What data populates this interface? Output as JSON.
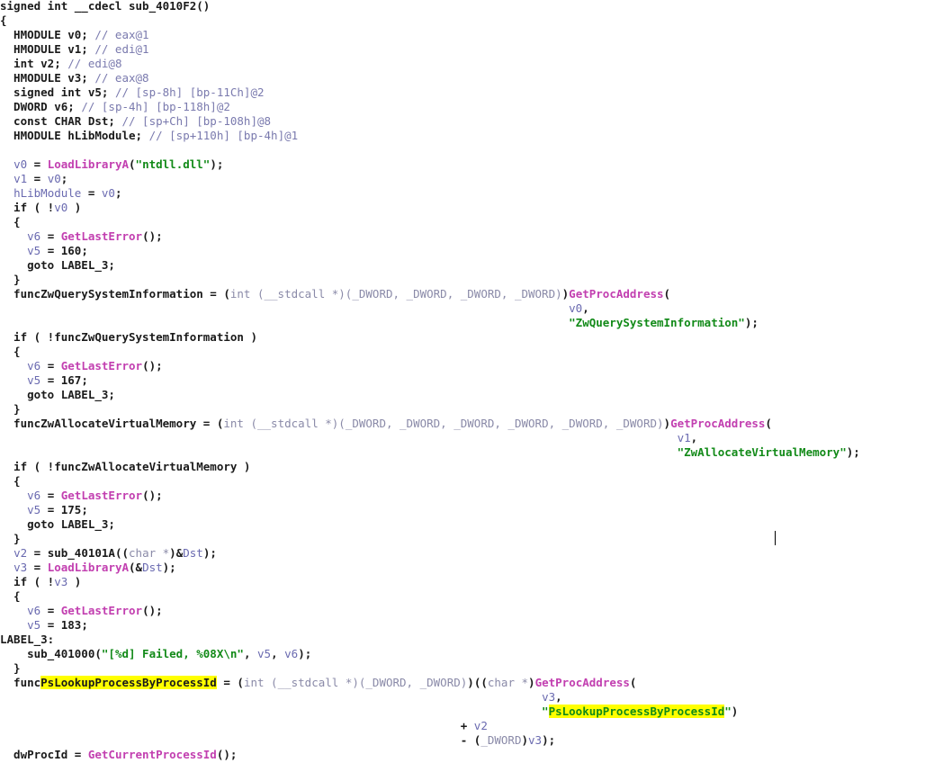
{
  "editor": {
    "kind": "decompiler-pseudocode",
    "colors": {
      "default": "#1a1a1a",
      "comment": "#7a7aae",
      "variable": "#6a6ab0",
      "function": "#c23fb0",
      "string": "#128a18",
      "highlight": "#ffff00",
      "background": "#ffffff"
    },
    "lines": [
      [
        {
          "t": "signed int __cdecl sub_4010F2()",
          "c": "default"
        }
      ],
      [
        {
          "t": "{",
          "c": "default"
        }
      ],
      [
        {
          "t": "  HMODULE v0; ",
          "c": "default"
        },
        {
          "t": "// eax@1",
          "c": "comment"
        }
      ],
      [
        {
          "t": "  HMODULE v1; ",
          "c": "default"
        },
        {
          "t": "// edi@1",
          "c": "comment"
        }
      ],
      [
        {
          "t": "  int v2; ",
          "c": "default"
        },
        {
          "t": "// edi@8",
          "c": "comment"
        }
      ],
      [
        {
          "t": "  HMODULE v3; ",
          "c": "default"
        },
        {
          "t": "// eax@8",
          "c": "comment"
        }
      ],
      [
        {
          "t": "  signed int v5; ",
          "c": "default"
        },
        {
          "t": "// [sp-8h] [bp-11Ch]@2",
          "c": "comment"
        }
      ],
      [
        {
          "t": "  DWORD v6; ",
          "c": "default"
        },
        {
          "t": "// [sp-4h] [bp-118h]@2",
          "c": "comment"
        }
      ],
      [
        {
          "t": "  const CHAR Dst; ",
          "c": "default"
        },
        {
          "t": "// [sp+Ch] [bp-108h]@8",
          "c": "comment"
        }
      ],
      [
        {
          "t": "  HMODULE hLibModule; ",
          "c": "default"
        },
        {
          "t": "// [sp+110h] [bp-4h]@1",
          "c": "comment"
        }
      ],
      [
        {
          "t": "",
          "c": "default"
        }
      ],
      [
        {
          "t": "  ",
          "c": "default"
        },
        {
          "t": "v0",
          "c": "var"
        },
        {
          "t": " = ",
          "c": "default"
        },
        {
          "t": "LoadLibraryA",
          "c": "func"
        },
        {
          "t": "(",
          "c": "default"
        },
        {
          "t": "\"ntdll.dll\"",
          "c": "string"
        },
        {
          "t": ");",
          "c": "default"
        }
      ],
      [
        {
          "t": "  ",
          "c": "default"
        },
        {
          "t": "v1",
          "c": "var"
        },
        {
          "t": " = ",
          "c": "default"
        },
        {
          "t": "v0",
          "c": "var"
        },
        {
          "t": ";",
          "c": "default"
        }
      ],
      [
        {
          "t": "  ",
          "c": "default"
        },
        {
          "t": "hLibModule",
          "c": "var"
        },
        {
          "t": " = ",
          "c": "default"
        },
        {
          "t": "v0",
          "c": "var"
        },
        {
          "t": ";",
          "c": "default"
        }
      ],
      [
        {
          "t": "  if ( !",
          "c": "default"
        },
        {
          "t": "v0",
          "c": "var"
        },
        {
          "t": " )",
          "c": "default"
        }
      ],
      [
        {
          "t": "  {",
          "c": "default"
        }
      ],
      [
        {
          "t": "    ",
          "c": "default"
        },
        {
          "t": "v6",
          "c": "var"
        },
        {
          "t": " = ",
          "c": "default"
        },
        {
          "t": "GetLastError",
          "c": "func"
        },
        {
          "t": "();",
          "c": "default"
        }
      ],
      [
        {
          "t": "    ",
          "c": "default"
        },
        {
          "t": "v5",
          "c": "var"
        },
        {
          "t": " = 160;",
          "c": "default"
        }
      ],
      [
        {
          "t": "    goto LABEL_3;",
          "c": "default"
        }
      ],
      [
        {
          "t": "  }",
          "c": "default"
        }
      ],
      [
        {
          "t": "  funcZwQuerySystemInformation = (",
          "c": "default"
        },
        {
          "t": "int (__stdcall *)(_DWORD, _DWORD, _DWORD, _DWORD)",
          "c": "type"
        },
        {
          "t": ")",
          "c": "default"
        },
        {
          "t": "GetProcAddress",
          "c": "func"
        },
        {
          "t": "(",
          "c": "default"
        }
      ],
      [
        {
          "t": "                                                                                    ",
          "c": "default"
        },
        {
          "t": "v0",
          "c": "var"
        },
        {
          "t": ",",
          "c": "default"
        }
      ],
      [
        {
          "t": "                                                                                    ",
          "c": "default"
        },
        {
          "t": "\"ZwQuerySystemInformation\"",
          "c": "string"
        },
        {
          "t": ");",
          "c": "default"
        }
      ],
      [
        {
          "t": "  if ( !funcZwQuerySystemInformation )",
          "c": "default"
        }
      ],
      [
        {
          "t": "  {",
          "c": "default"
        }
      ],
      [
        {
          "t": "    ",
          "c": "default"
        },
        {
          "t": "v6",
          "c": "var"
        },
        {
          "t": " = ",
          "c": "default"
        },
        {
          "t": "GetLastError",
          "c": "func"
        },
        {
          "t": "();",
          "c": "default"
        }
      ],
      [
        {
          "t": "    ",
          "c": "default"
        },
        {
          "t": "v5",
          "c": "var"
        },
        {
          "t": " = 167;",
          "c": "default"
        }
      ],
      [
        {
          "t": "    goto LABEL_3;",
          "c": "default"
        }
      ],
      [
        {
          "t": "  }",
          "c": "default"
        }
      ],
      [
        {
          "t": "  funcZwAllocateVirtualMemory = (",
          "c": "default"
        },
        {
          "t": "int (__stdcall *)(_DWORD, _DWORD, _DWORD, _DWORD, _DWORD, _DWORD)",
          "c": "type"
        },
        {
          "t": ")",
          "c": "default"
        },
        {
          "t": "GetProcAddress",
          "c": "func"
        },
        {
          "t": "(",
          "c": "default"
        }
      ],
      [
        {
          "t": "                                                                                                    ",
          "c": "default"
        },
        {
          "t": "v1",
          "c": "var"
        },
        {
          "t": ",",
          "c": "default"
        }
      ],
      [
        {
          "t": "                                                                                                    ",
          "c": "default"
        },
        {
          "t": "\"ZwAllocateVirtualMemory\"",
          "c": "string"
        },
        {
          "t": ");",
          "c": "default"
        }
      ],
      [
        {
          "t": "  if ( !funcZwAllocateVirtualMemory )",
          "c": "default"
        }
      ],
      [
        {
          "t": "  {",
          "c": "default"
        }
      ],
      [
        {
          "t": "    ",
          "c": "default"
        },
        {
          "t": "v6",
          "c": "var"
        },
        {
          "t": " = ",
          "c": "default"
        },
        {
          "t": "GetLastError",
          "c": "func"
        },
        {
          "t": "();",
          "c": "default"
        }
      ],
      [
        {
          "t": "    ",
          "c": "default"
        },
        {
          "t": "v5",
          "c": "var"
        },
        {
          "t": " = 175;",
          "c": "default"
        }
      ],
      [
        {
          "t": "    goto LABEL_3;",
          "c": "default"
        }
      ],
      [
        {
          "t": "  }",
          "c": "default"
        }
      ],
      [
        {
          "t": "  ",
          "c": "default"
        },
        {
          "t": "v2",
          "c": "var"
        },
        {
          "t": " = sub_40101A((",
          "c": "default"
        },
        {
          "t": "char *",
          "c": "type"
        },
        {
          "t": ")&",
          "c": "default"
        },
        {
          "t": "Dst",
          "c": "var"
        },
        {
          "t": ");",
          "c": "default"
        }
      ],
      [
        {
          "t": "  ",
          "c": "default"
        },
        {
          "t": "v3",
          "c": "var"
        },
        {
          "t": " = ",
          "c": "default"
        },
        {
          "t": "LoadLibraryA",
          "c": "func"
        },
        {
          "t": "(&",
          "c": "default"
        },
        {
          "t": "Dst",
          "c": "var"
        },
        {
          "t": ");",
          "c": "default"
        }
      ],
      [
        {
          "t": "  if ( !",
          "c": "default"
        },
        {
          "t": "v3",
          "c": "var"
        },
        {
          "t": " )",
          "c": "default"
        }
      ],
      [
        {
          "t": "  {",
          "c": "default"
        }
      ],
      [
        {
          "t": "    ",
          "c": "default"
        },
        {
          "t": "v6",
          "c": "var"
        },
        {
          "t": " = ",
          "c": "default"
        },
        {
          "t": "GetLastError",
          "c": "func"
        },
        {
          "t": "();",
          "c": "default"
        }
      ],
      [
        {
          "t": "    ",
          "c": "default"
        },
        {
          "t": "v5",
          "c": "var"
        },
        {
          "t": " = 183;",
          "c": "default"
        }
      ],
      [
        {
          "t": "LABEL_3:",
          "c": "default"
        }
      ],
      [
        {
          "t": "    sub_401000(",
          "c": "default"
        },
        {
          "t": "\"[%d] Failed, %08X\\n\"",
          "c": "string"
        },
        {
          "t": ", ",
          "c": "default"
        },
        {
          "t": "v5",
          "c": "var"
        },
        {
          "t": ", ",
          "c": "default"
        },
        {
          "t": "v6",
          "c": "var"
        },
        {
          "t": ");",
          "c": "default"
        }
      ],
      [
        {
          "t": "  }",
          "c": "default"
        }
      ],
      [
        {
          "t": "  func",
          "c": "default"
        },
        {
          "t": "PsLookupProcessByProcessId",
          "c": "default",
          "hl": true
        },
        {
          "t": " = (",
          "c": "default"
        },
        {
          "t": "int (__stdcall *)(_DWORD, _DWORD)",
          "c": "type"
        },
        {
          "t": ")((",
          "c": "default"
        },
        {
          "t": "char *",
          "c": "type"
        },
        {
          "t": ")",
          "c": "default"
        },
        {
          "t": "GetProcAddress",
          "c": "func"
        },
        {
          "t": "(",
          "c": "default"
        }
      ],
      [
        {
          "t": "                                                                                ",
          "c": "default"
        },
        {
          "t": "v3",
          "c": "var"
        },
        {
          "t": ",",
          "c": "default"
        }
      ],
      [
        {
          "t": "                                                                                \"",
          "c": "string"
        },
        {
          "t": "PsLookupProcessByProcessId",
          "c": "string",
          "hl": true
        },
        {
          "t": "\"",
          "c": "string"
        },
        {
          "t": ")",
          "c": "default"
        }
      ],
      [
        {
          "t": "                                                                    + ",
          "c": "default"
        },
        {
          "t": "v2",
          "c": "var"
        }
      ],
      [
        {
          "t": "                                                                    - (",
          "c": "default"
        },
        {
          "t": "_DWORD",
          "c": "type"
        },
        {
          "t": ")",
          "c": "default"
        },
        {
          "t": "v3",
          "c": "var"
        },
        {
          "t": ");",
          "c": "default"
        }
      ],
      [
        {
          "t": "  dwProcId = ",
          "c": "default"
        },
        {
          "t": "GetCurrentProcessId",
          "c": "func"
        },
        {
          "t": "();",
          "c": "default"
        }
      ]
    ]
  }
}
